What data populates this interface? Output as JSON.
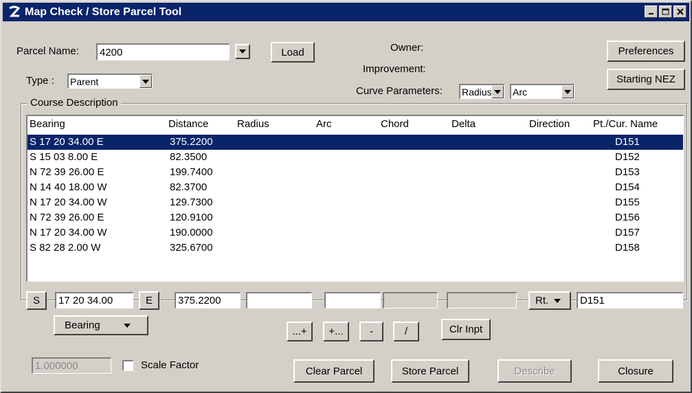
{
  "window": {
    "title": "Map Check / Store Parcel Tool"
  },
  "parcel": {
    "name_label": "Parcel Name:",
    "name_value": "4200",
    "load_label": "Load"
  },
  "type": {
    "label": "Type :",
    "value": "Parent"
  },
  "info": {
    "owner_label": "Owner:",
    "improvement_label": "Improvement:",
    "curve_params_label": "Curve Parameters:",
    "curve_param1": "Radius",
    "curve_param2": "Arc"
  },
  "buttons": {
    "preferences": "Preferences",
    "starting_nez": "Starting NEZ"
  },
  "course": {
    "title": "Course Description",
    "columns": [
      "Bearing",
      "Distance",
      "Radius",
      "Arc",
      "Chord",
      "Delta",
      "Direction",
      "Pt./Cur. Name"
    ],
    "rows": [
      {
        "bearing": "S 17 20 34.00 E",
        "distance": "375.2200",
        "name": "D151"
      },
      {
        "bearing": "S 15 03 8.00 E",
        "distance": "82.3500",
        "name": "D152"
      },
      {
        "bearing": "N 72 39 26.00 E",
        "distance": "199.7400",
        "name": "D153"
      },
      {
        "bearing": "N 14 40 18.00 W",
        "distance": "82.3700",
        "name": "D154"
      },
      {
        "bearing": "N 17 20 34.00 W",
        "distance": "129.7300",
        "name": "D155"
      },
      {
        "bearing": "N 72 39 26.00 E",
        "distance": "120.9100",
        "name": "D156"
      },
      {
        "bearing": "N 17 20 34.00 W",
        "distance": "190.0000",
        "name": "D157"
      },
      {
        "bearing": "S 82 28 2.00 W",
        "distance": "325.6700",
        "name": "D158"
      }
    ],
    "selected_index": 0
  },
  "input": {
    "ns": "S",
    "angle": "17 20 34.00",
    "ew": "E",
    "distance": "375.2200",
    "direction": "Rt.",
    "name": "D151",
    "mode": "Bearing",
    "ops": [
      "...+",
      "+...",
      "-",
      "/"
    ],
    "clear_input": "Clr Inpt"
  },
  "bottom": {
    "scale_value": "1.000000",
    "scale_label": "Scale Factor",
    "clear_parcel": "Clear Parcel",
    "store_parcel": "Store Parcel",
    "describe": "Describe",
    "closure": "Closure"
  },
  "colors": {
    "titlebar": "#0a246a",
    "face": "#d4d0c8",
    "selection": "#0a246a"
  }
}
